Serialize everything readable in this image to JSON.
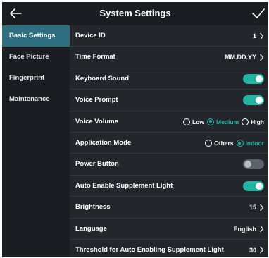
{
  "header": {
    "title": "System Settings",
    "back_icon": "arrow-left-icon",
    "confirm_icon": "checkmark-icon"
  },
  "sidebar": {
    "items": [
      {
        "label": "Basic Settings",
        "active": true
      },
      {
        "label": "Face Picture",
        "active": false
      },
      {
        "label": "Fingerprint",
        "active": false
      },
      {
        "label": "Maintenance",
        "active": false
      }
    ]
  },
  "settings": {
    "device_id": {
      "label": "Device ID",
      "value": "1"
    },
    "time_format": {
      "label": "Time Format",
      "value": "MM.DD.YY"
    },
    "keyboard_sound": {
      "label": "Keyboard Sound",
      "enabled": true
    },
    "voice_prompt": {
      "label": "Voice Prompt",
      "enabled": true
    },
    "voice_volume": {
      "label": "Voice Volume",
      "options": [
        "Low",
        "Medium",
        "High"
      ],
      "selected": "Medium"
    },
    "application_mode": {
      "label": "Application Mode",
      "options": [
        "Others",
        "Indoor"
      ],
      "selected": "Indoor"
    },
    "power_button": {
      "label": "Power Button",
      "enabled": false
    },
    "auto_supplement_light": {
      "label": "Auto Enable Supplement Light",
      "enabled": true
    },
    "brightness": {
      "label": "Brightness",
      "value": "15"
    },
    "language": {
      "label": "Language",
      "value": "English"
    },
    "threshold": {
      "label": "Threshold for Auto Enabling Supplement Light",
      "value": "30"
    }
  },
  "colors": {
    "accent": "#23b4a4",
    "active_tab": "#2d6f80",
    "background": "#1a1d21",
    "panel": "#23272c"
  }
}
